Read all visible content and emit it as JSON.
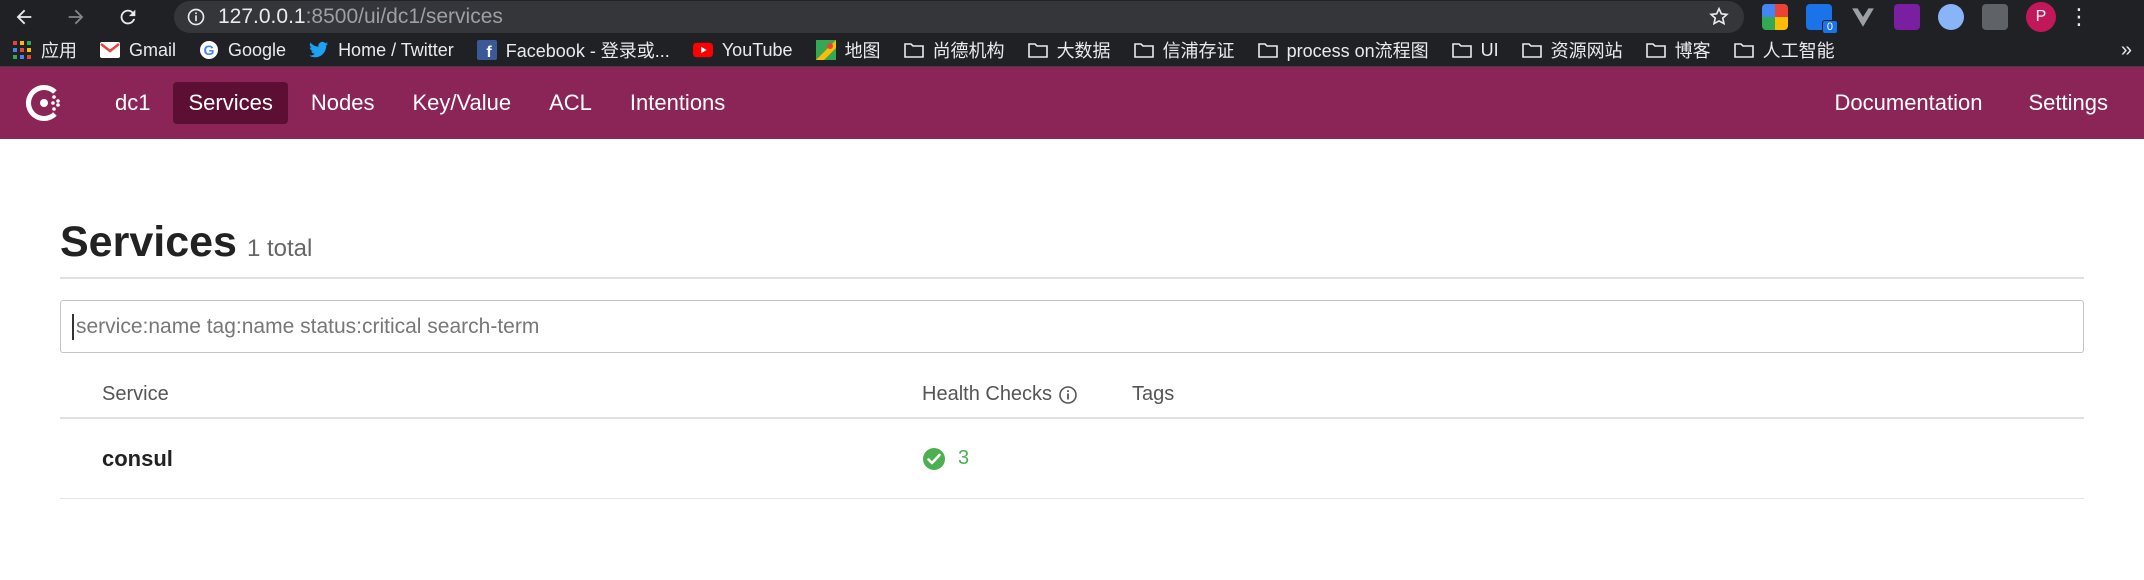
{
  "browser": {
    "url_host": "127.0.0.1",
    "url_rest": ":8500/ui/dc1/services",
    "profile_initial": "P",
    "bookmarks": [
      {
        "label": "应用",
        "icon": "apps-grid-icon"
      },
      {
        "label": "Gmail",
        "icon": "gmail-icon"
      },
      {
        "label": "Google",
        "icon": "google-icon"
      },
      {
        "label": "Home / Twitter",
        "icon": "twitter-icon"
      },
      {
        "label": "Facebook - 登录或...",
        "icon": "facebook-icon"
      },
      {
        "label": "YouTube",
        "icon": "youtube-icon"
      },
      {
        "label": "地图",
        "icon": "maps-icon"
      },
      {
        "label": "尚德机构",
        "icon": "folder-icon"
      },
      {
        "label": "大数据",
        "icon": "folder-icon"
      },
      {
        "label": "信浦存证",
        "icon": "folder-icon"
      },
      {
        "label": "process on流程图",
        "icon": "folder-icon"
      },
      {
        "label": "UI",
        "icon": "folder-icon"
      },
      {
        "label": "资源网站",
        "icon": "folder-icon"
      },
      {
        "label": "博客",
        "icon": "folder-icon"
      },
      {
        "label": "人工智能",
        "icon": "folder-icon"
      }
    ],
    "more_label": "»",
    "ext_badge": "0"
  },
  "header": {
    "datacenter": "dc1",
    "nav": [
      "Services",
      "Nodes",
      "Key/Value",
      "ACL",
      "Intentions"
    ],
    "active": "Services",
    "right": [
      "Documentation",
      "Settings"
    ],
    "brand_color": "#8b2557"
  },
  "page": {
    "title": "Services",
    "count": "1 total",
    "search_placeholder": "service:name tag:name status:critical search-term"
  },
  "table": {
    "headers": {
      "service": "Service",
      "health": "Health Checks",
      "tags": "Tags"
    },
    "rows": [
      {
        "service": "consul",
        "health": "3",
        "tags": ""
      }
    ]
  }
}
